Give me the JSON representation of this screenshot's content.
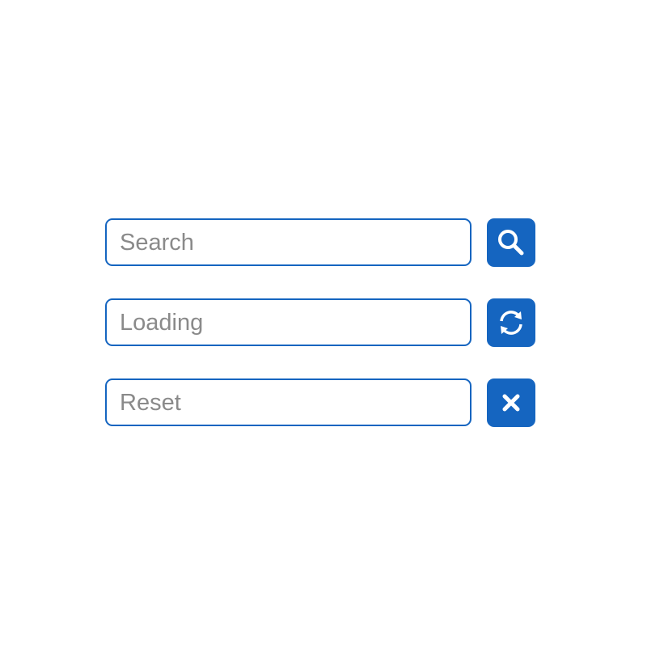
{
  "accent_color": "#1565c0",
  "placeholder_color": "#8a8a8a",
  "rows": [
    {
      "label": "Search",
      "button_icon": "search-icon"
    },
    {
      "label": "Loading",
      "button_icon": "refresh-icon"
    },
    {
      "label": "Reset",
      "button_icon": "close-icon"
    }
  ]
}
